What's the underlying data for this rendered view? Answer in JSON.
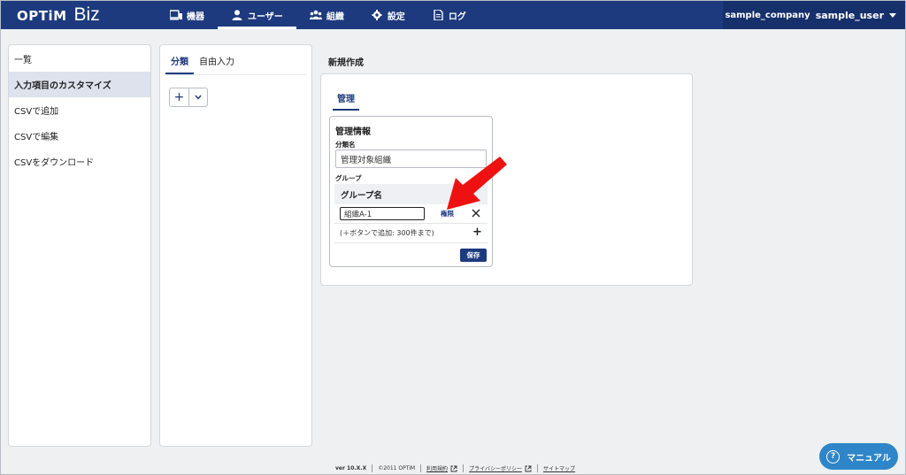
{
  "header": {
    "logo_main": "OPTiM",
    "logo_sub": "Biz",
    "nav": [
      {
        "label": "機器",
        "icon": "devices-icon"
      },
      {
        "label": "ユーザー",
        "icon": "user-icon",
        "active": true
      },
      {
        "label": "組織",
        "icon": "organization-icon"
      },
      {
        "label": "設定",
        "icon": "gear-icon"
      },
      {
        "label": "ログ",
        "icon": "document-icon"
      }
    ],
    "company": "sample_company",
    "user": "sample_user"
  },
  "sidebar": {
    "items": [
      {
        "label": "一覧"
      },
      {
        "label": "入力項目のカスタマイズ",
        "active": true
      },
      {
        "label": "CSVで追加"
      },
      {
        "label": "CSVで編集"
      },
      {
        "label": "CSVをダウンロード"
      }
    ]
  },
  "middle": {
    "tabs": [
      {
        "label": "分類",
        "active": true
      },
      {
        "label": "自由入力"
      }
    ],
    "add_symbol": "+"
  },
  "main": {
    "section_title": "新規作成",
    "tab": "管理",
    "card": {
      "title": "管理情報",
      "category_label": "分類名",
      "category_value": "管理対象組織",
      "group_label": "グループ",
      "group_header": "グループ名",
      "group_rows": [
        {
          "value": "組織A-1",
          "perm_label": "権限",
          "remove_symbol": "✕"
        }
      ],
      "hint": "(＋ボタンで追加: 300件まで)",
      "add_symbol": "+",
      "save_label": "保存"
    }
  },
  "footer": {
    "version": "ver 10.X.X",
    "copyright": "©2011 OPTiM",
    "terms": "利用規約",
    "privacy": "プライバシーポリシー",
    "sitemap": "サイトマップ"
  },
  "manual_button": {
    "label": "マニュアル",
    "icon_symbol": "?"
  },
  "colors": {
    "brand": "#1d3a7e",
    "accent_button": "#2e86c9",
    "arrow": "#ee1111"
  }
}
